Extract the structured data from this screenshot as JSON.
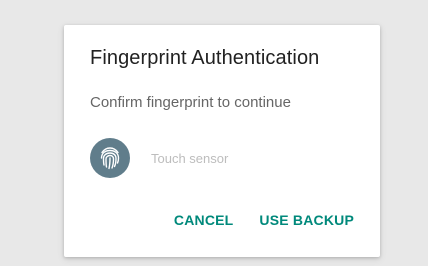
{
  "dialog": {
    "title": "Fingerprint Authentication",
    "description": "Confirm fingerprint to continue",
    "sensor": {
      "icon": "fingerprint-icon",
      "text": "Touch sensor"
    },
    "actions": {
      "cancel_label": "CANCEL",
      "use_backup_label": "USE BACKUP"
    }
  },
  "colors": {
    "background": "#e8e8e8",
    "dialog_background": "#ffffff",
    "accent": "#00897b",
    "icon_background": "#607d8b",
    "title_text": "#212121",
    "hint_text": "#bdbdbd"
  }
}
